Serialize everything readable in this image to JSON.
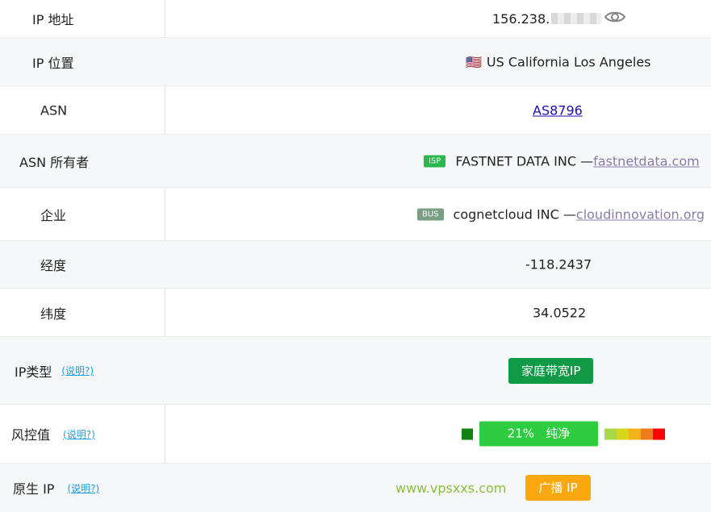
{
  "rows": {
    "ip_address": {
      "label": "IP 地址",
      "value_prefix": "156.238."
    },
    "ip_location": {
      "label": "IP 位置",
      "flag": "🇺🇸",
      "value": "US California Los Angeles"
    },
    "asn": {
      "label": "ASN",
      "value": "AS8796"
    },
    "asn_owner": {
      "label": "ASN 所有者",
      "tag": "ISP",
      "name": "FASTNET DATA INC —",
      "domain": "fastnetdata.com"
    },
    "company": {
      "label": "企业",
      "tag": "BUS",
      "name": "cognetcloud INC —",
      "domain": "cloudinnovation.org"
    },
    "longitude": {
      "label": "经度",
      "value": "-118.2437"
    },
    "latitude": {
      "label": "纬度",
      "value": "34.0522"
    },
    "ip_type": {
      "label": "IP类型",
      "help": "(说明?)",
      "badge": "家庭带宽IP"
    },
    "risk": {
      "label": "风控值",
      "help": "(说明?)",
      "percent": "21%",
      "status": "纯净",
      "scale_colors": [
        "#a8d84a",
        "#d6d61a",
        "#f3b21a",
        "#f07b1a",
        "#ff0000"
      ]
    },
    "native_ip": {
      "label": "原生 IP",
      "help": "(说明?)",
      "watermark": "www.vpsxxs.com",
      "badge": "广播 IP"
    }
  }
}
